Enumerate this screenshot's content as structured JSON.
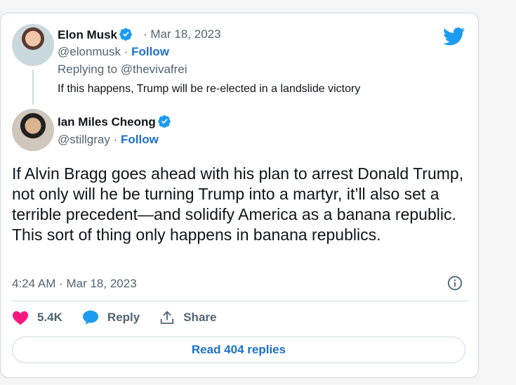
{
  "quoted": {
    "author_name": "Elon Musk",
    "date": "· Mar 18, 2023",
    "handle": "@elonmusk ·",
    "follow": "Follow",
    "replying_to": "Replying to @thevivafrei",
    "text": "If this happens, Trump will be re-elected in a landslide victory"
  },
  "tweet": {
    "author_name": "Ian Miles Cheong",
    "handle": "@stillgray ·",
    "follow": "Follow",
    "text": "If Alvin Bragg goes ahead with his plan to arrest Donald Trump, not only will he be turning Trump into a martyr, it’ll also set a terrible precedent—and solidify America as a banana republic. This sort of thing only happens in banana republics.",
    "timestamp": "4:24 AM · Mar 18, 2023"
  },
  "actions": {
    "likes": "5.4K",
    "reply": "Reply",
    "share": "Share"
  },
  "read_replies": "Read 404 replies",
  "colors": {
    "brand": "#1d9bf0",
    "link": "#1d70c9",
    "heart": "#f91880",
    "muted": "#536471",
    "text": "#0f1419"
  },
  "icons": [
    "twitter-bird-icon",
    "verified-badge-icon",
    "info-icon",
    "heart-icon",
    "reply-bubble-icon",
    "share-icon"
  ]
}
